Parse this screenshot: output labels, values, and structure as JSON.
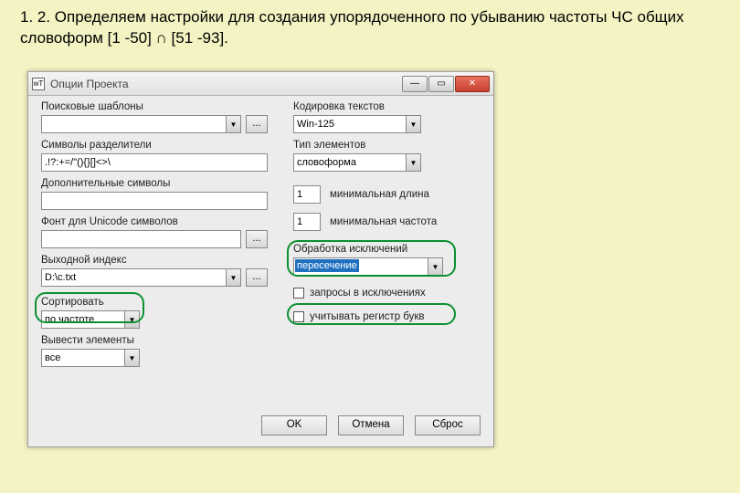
{
  "heading": "1. 2. Определяем настройки для создания упорядоченного по убыванию частоты ЧС общих словоформ [1 -50] ∩ [51 -93].",
  "window": {
    "icon": "wT",
    "title": "Опции Проекта",
    "buttons": {
      "min": "—",
      "max": "▭",
      "close": "✕",
      "ok": "OK",
      "cancel": "Отмена",
      "reset": "Сброс"
    }
  },
  "left": {
    "search_label": "Поисковые шаблоны",
    "search_value": "",
    "delim_label": "Символы разделители",
    "delim_value": ".!?:+=/\"(){}[]<>\\",
    "addsym_label": "Дополнительные символы",
    "addsym_value": "",
    "font_label": "Фонт для Unicode символов",
    "font_value": "",
    "index_label": "Выходной индекс",
    "index_value": "D:\\c.txt",
    "sort_label": "Сортировать",
    "sort_value": "по частоте",
    "output_label": "Вывести элементы",
    "output_value": "все"
  },
  "right": {
    "enc_label": "Кодировка текстов",
    "enc_value": "Win-125",
    "type_label": "Тип элементов",
    "type_value": "словоформа",
    "minlen_label": "минимальная длина",
    "minlen_value": "1",
    "minfreq_label": "минимальная частота",
    "minfreq_value": "1",
    "excl_label": "Обработка исключений",
    "excl_value": "пересечение",
    "req_label": "запросы в исключениях",
    "case_label": "учитывать регистр букв"
  }
}
